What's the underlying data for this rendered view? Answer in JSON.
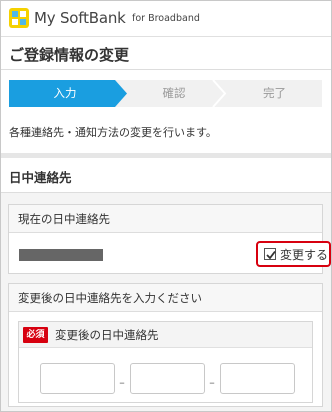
{
  "header": {
    "logo_icon": "softbank-square-logo-icon",
    "brand": "My SoftBank",
    "brand_sub": "for Broadband"
  },
  "page": {
    "title": "ご登録情報の変更",
    "intro": "各種連絡先・通知方法の変更を行います。"
  },
  "steps": [
    {
      "label": "入力",
      "active": true
    },
    {
      "label": "確認",
      "active": false
    },
    {
      "label": "完了",
      "active": false
    }
  ],
  "section": {
    "title": "日中連絡先",
    "current": {
      "heading": "現在の日中連絡先",
      "change_label": "変更する",
      "change_checked": true
    },
    "new": {
      "heading": "変更後の日中連絡先を入力ください",
      "required_badge": "必須",
      "field_label": "変更後の日中連絡先",
      "separator": "–",
      "inputs": [
        "",
        "",
        ""
      ]
    }
  },
  "colors": {
    "step_active": "#1a9ee0",
    "step_inactive": "#f1f1f1",
    "required": "#d7000f",
    "highlight_border": "#d7000f",
    "logo_yellow": "#f5d100",
    "logo_blue": "#4fb8e8"
  }
}
